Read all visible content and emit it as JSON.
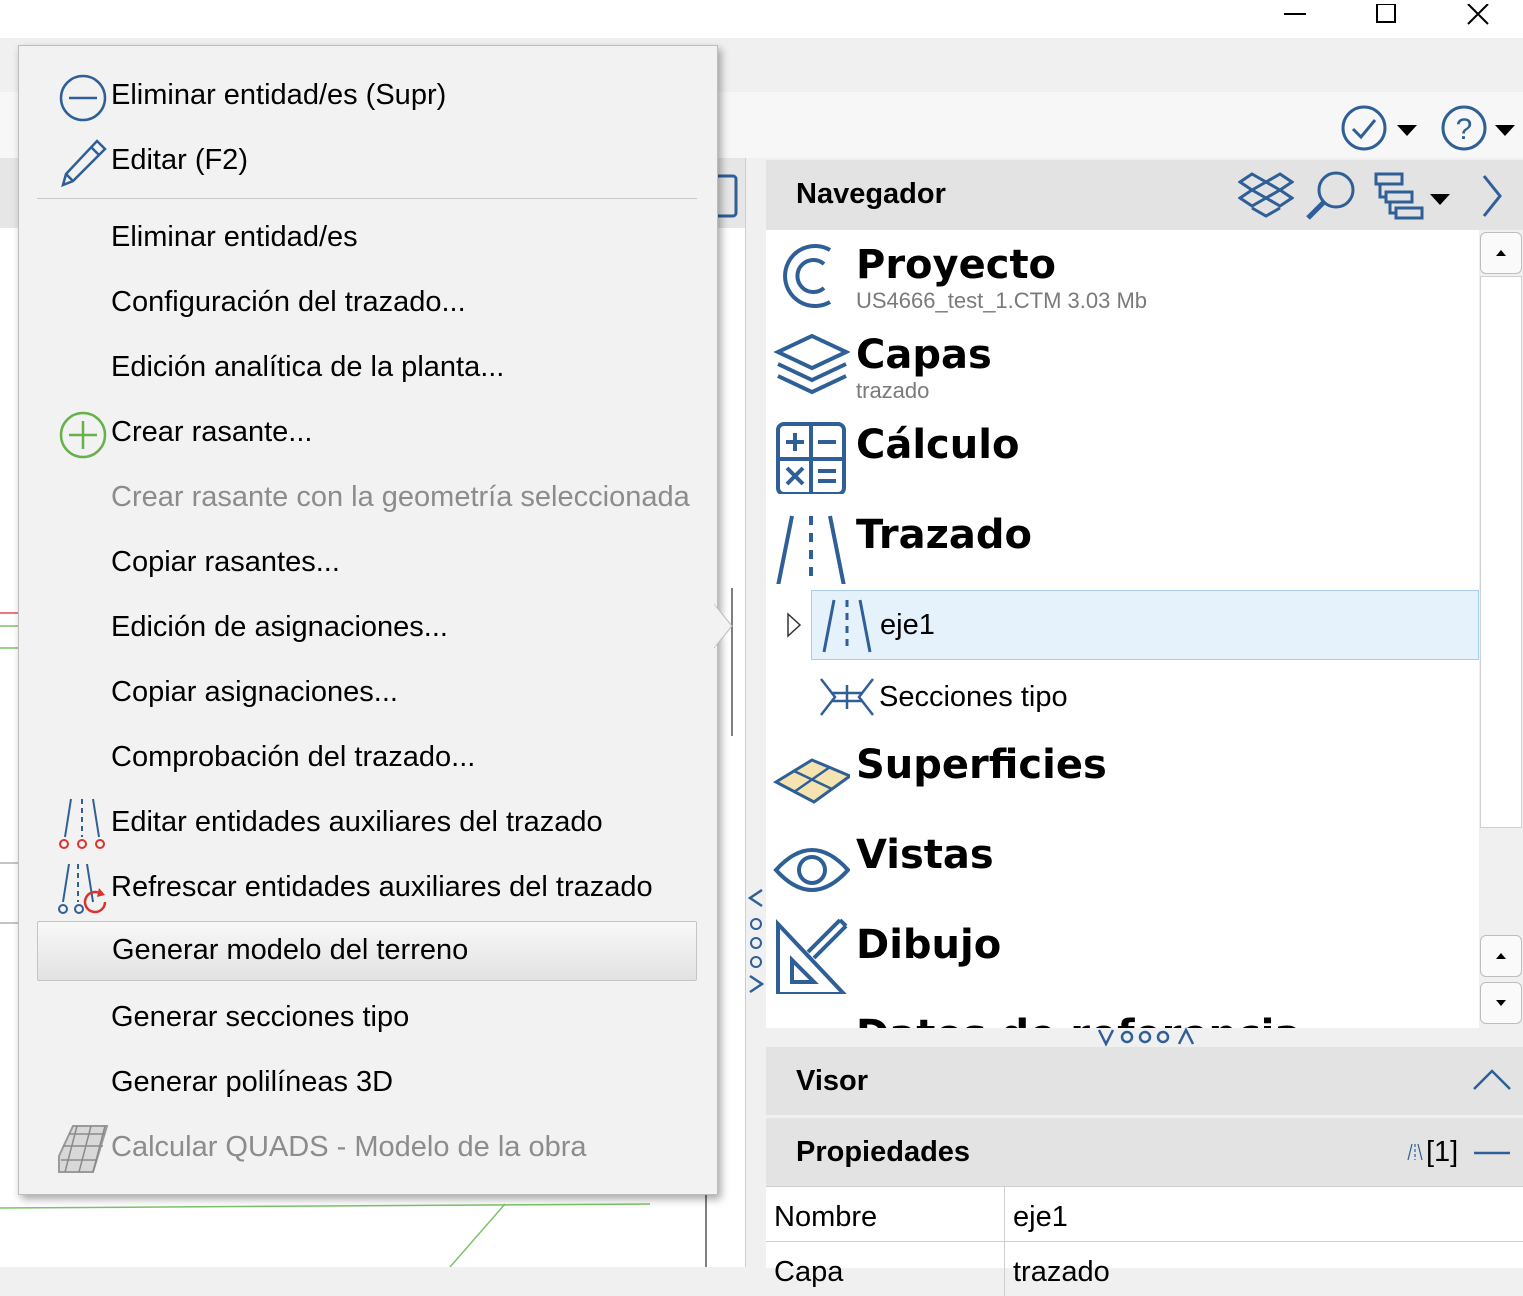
{
  "window": {
    "minimize_icon": "minimize-icon",
    "maximize_icon": "maximize-icon",
    "close_icon": "close-icon"
  },
  "context_menu": {
    "items": [
      {
        "label": "Eliminar entidad/es (Supr)",
        "icon": "minus-circle-icon",
        "enabled": true
      },
      {
        "label": "Editar (F2)",
        "icon": "pencil-icon",
        "enabled": true
      },
      {
        "label": "Eliminar entidad/es",
        "enabled": true
      },
      {
        "label": "Configuración del trazado...",
        "enabled": true
      },
      {
        "label": "Edición analítica de la planta...",
        "enabled": true
      },
      {
        "label": "Crear rasante...",
        "icon": "plus-circle-icon",
        "enabled": true
      },
      {
        "label": "Crear rasante con la geometría seleccionada",
        "enabled": false
      },
      {
        "label": "Copiar rasantes...",
        "enabled": true
      },
      {
        "label": "Edición de asignaciones...",
        "enabled": true
      },
      {
        "label": "Copiar asignaciones...",
        "enabled": true
      },
      {
        "label": "Comprobación del trazado...",
        "enabled": true
      },
      {
        "label": "Editar entidades auxiliares del trazado",
        "icon": "road-aux-icon",
        "enabled": true
      },
      {
        "label": "Refrescar entidades auxiliares del trazado",
        "icon": "road-refresh-icon",
        "enabled": true
      },
      {
        "label": "Generar modelo del terreno",
        "enabled": true,
        "highlighted": true
      },
      {
        "label": "Generar secciones tipo",
        "enabled": true
      },
      {
        "label": "Generar polilíneas 3D",
        "enabled": true
      },
      {
        "label": "Calcular QUADS - Modelo de la obra",
        "icon": "quads-grid-icon",
        "enabled": false
      }
    ]
  },
  "navigator": {
    "title": "Navegador",
    "items": [
      {
        "label": "Proyecto",
        "sub": "US4666_test_1.CTM 3.03 Mb",
        "icon": "project-c-icon"
      },
      {
        "label": "Capas",
        "sub": "trazado",
        "icon": "layers-icon"
      },
      {
        "label": "Cálculo",
        "icon": "calculator-icon"
      },
      {
        "label": "Trazado",
        "icon": "road-icon"
      },
      {
        "label": "eje1",
        "icon": "road-icon",
        "selected": true
      },
      {
        "label": "Secciones tipo",
        "icon": "cross-section-icon"
      },
      {
        "label": "Superficies",
        "icon": "surface-icon"
      },
      {
        "label": "Vistas",
        "icon": "eye-icon"
      },
      {
        "label": "Dibujo",
        "icon": "drawing-triangle-icon"
      },
      {
        "label": "Datos de referencia"
      }
    ]
  },
  "visor": {
    "title": "Visor"
  },
  "properties": {
    "title": "Propiedades",
    "count": "[1]",
    "rows": [
      {
        "name": "Nombre",
        "value": "eje1"
      },
      {
        "name": "Capa",
        "value": "trazado"
      }
    ]
  },
  "colors": {
    "accent": "#2e5f96",
    "green": "#66b24a",
    "red": "#d9342b",
    "selection": "#e5f1fb",
    "selection_border": "#a8cdef"
  }
}
